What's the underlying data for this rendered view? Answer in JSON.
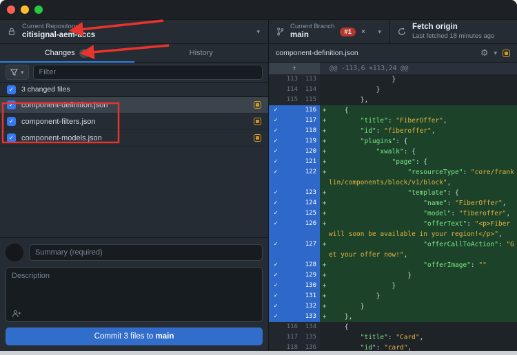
{
  "colors": {
    "accent_blue": "#316dca",
    "modified_yellow": "#d29922",
    "added_green_bg": "#1c432a",
    "added_gutter_blue": "#2e68c8",
    "badge_red": "#b5372f",
    "annotation_red": "#e8342c"
  },
  "icons": {
    "chevron": "▾",
    "check": "✓",
    "gear": "⚙",
    "arrow_up": "↑",
    "close": "×"
  },
  "toolbar": {
    "repository": {
      "label": "Current Repository",
      "name": "citisignal-aem-accs"
    },
    "branch": {
      "label": "Current Branch",
      "name": "main",
      "pr_badge": "#1",
      "badge_close": "×"
    },
    "fetch": {
      "title": "Fetch origin",
      "subtitle": "Last fetched 18 minutes ago"
    }
  },
  "tabs": {
    "changes_label": "Changes",
    "changes_count": "3",
    "history_label": "History"
  },
  "sidebar": {
    "filter_placeholder": "Filter",
    "changed_files_summary": "3 changed files",
    "files": [
      {
        "name": "component-definition.json",
        "status": "modified",
        "checked": true,
        "selected": true
      },
      {
        "name": "component-filters.json",
        "status": "modified",
        "checked": true,
        "selected": false
      },
      {
        "name": "component-models.json",
        "status": "modified",
        "checked": true,
        "selected": false
      }
    ],
    "commit": {
      "summary_placeholder": "Summary (required)",
      "description_placeholder": "Description",
      "button_prefix": "Commit 3 files to",
      "button_branch": "main"
    }
  },
  "diff": {
    "filename": "component-definition.json",
    "hunk_header": "@@ -113,6 +113,24 @@",
    "lines": [
      {
        "old": "113",
        "new": "113",
        "type": "context",
        "text": "                }"
      },
      {
        "old": "114",
        "new": "114",
        "type": "context",
        "text": "            }"
      },
      {
        "old": "115",
        "new": "115",
        "type": "context",
        "text": "        },"
      },
      {
        "old": "",
        "new": "116",
        "type": "add",
        "text": "    {"
      },
      {
        "old": "",
        "new": "117",
        "type": "add",
        "text": "        \"title\": \"FiberOffer\","
      },
      {
        "old": "",
        "new": "118",
        "type": "add",
        "text": "        \"id\": \"fiberoffer\","
      },
      {
        "old": "",
        "new": "119",
        "type": "add",
        "text": "        \"plugins\": {"
      },
      {
        "old": "",
        "new": "120",
        "type": "add",
        "text": "            \"xwalk\": {"
      },
      {
        "old": "",
        "new": "121",
        "type": "add",
        "text": "                \"page\": {"
      },
      {
        "old": "",
        "new": "122",
        "type": "add",
        "text": "                    \"resourceType\": \"core/franklin/components/block/v1/block\","
      },
      {
        "old": "",
        "new": "123",
        "type": "add",
        "text": "                    \"template\": {"
      },
      {
        "old": "",
        "new": "124",
        "type": "add",
        "text": "                        \"name\": \"FiberOffer\","
      },
      {
        "old": "",
        "new": "125",
        "type": "add",
        "text": "                        \"model\": \"fiberoffer\","
      },
      {
        "old": "",
        "new": "126",
        "type": "add",
        "text": "                        \"offerText\": \"<p>Fiber will soon be available in your region!</p>\","
      },
      {
        "old": "",
        "new": "127",
        "type": "add",
        "text": "                        \"offerCallToAction\": \"Get your offer now!\","
      },
      {
        "old": "",
        "new": "128",
        "type": "add",
        "text": "                        \"offerImage\": \"\""
      },
      {
        "old": "",
        "new": "129",
        "type": "add",
        "text": "                    }"
      },
      {
        "old": "",
        "new": "130",
        "type": "add",
        "text": "                }"
      },
      {
        "old": "",
        "new": "131",
        "type": "add",
        "text": "            }"
      },
      {
        "old": "",
        "new": "132",
        "type": "add",
        "text": "        }"
      },
      {
        "old": "",
        "new": "133",
        "type": "add",
        "text": "    },"
      },
      {
        "old": "116",
        "new": "134",
        "type": "context",
        "text": "    {"
      },
      {
        "old": "117",
        "new": "135",
        "type": "context",
        "text": "        \"title\": \"Card\","
      },
      {
        "old": "118",
        "new": "136",
        "type": "context",
        "text": "        \"id\": \"card\","
      }
    ]
  }
}
